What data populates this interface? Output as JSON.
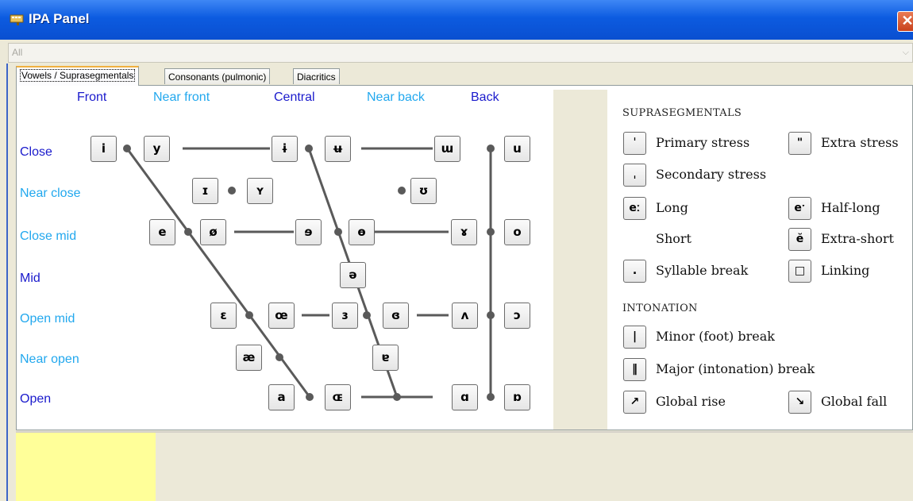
{
  "window": {
    "title": "IPA Panel",
    "close_glyph": "✕"
  },
  "filter": {
    "value": "All",
    "arrow": "⌵"
  },
  "tabs": [
    {
      "label": "Vowels / Suprasegmentals",
      "active": true
    },
    {
      "label": "Consonants (pulmonic)",
      "active": false
    },
    {
      "label": "Diacritics",
      "active": false
    }
  ],
  "vowel_chart": {
    "columns": [
      "Front",
      "Near front",
      "Central",
      "Near back",
      "Back"
    ],
    "rows": [
      "Close",
      "Near close",
      "Close mid",
      "Mid",
      "Open mid",
      "Near open",
      "Open"
    ],
    "colors": {
      "dark": "#1a1acc",
      "light": "#22a8ee",
      "line": "#5a5a5a"
    },
    "vowels": {
      "i": "i",
      "y": "y",
      "barred_i": "ɨ",
      "barred_u": "ʉ",
      "unrounded_u": "ɯ",
      "u": "u",
      "small_cap_i": "ɪ",
      "small_cap_y": "ʏ",
      "upsilon": "ʊ",
      "e": "e",
      "o_slash": "ø",
      "rev_e": "ɘ",
      "barred_o": "ɵ",
      "rams_horn": "ɤ",
      "o": "o",
      "schwa": "ə",
      "epsilon": "ɛ",
      "oe": "œ",
      "rev_epsilon": "ɜ",
      "closed_rev_epsilon": "ɞ",
      "turned_v": "ʌ",
      "open_o": "ɔ",
      "ash": "æ",
      "turned_a": "ɐ",
      "a": "a",
      "small_cap_oe": "ɶ",
      "script_a": "ɑ",
      "turned_script_a": "ɒ"
    }
  },
  "suprasegmentals": {
    "heading": "SUPRASEGMENTALS",
    "items": [
      {
        "symbol": "ˈ",
        "label": "Primary stress"
      },
      {
        "symbol": "\"",
        "label": "Extra stress"
      },
      {
        "symbol": "ˌ",
        "label": "Secondary stress"
      },
      {
        "symbol": "eː",
        "label": "Long"
      },
      {
        "symbol": "eˑ",
        "label": "Half-long"
      },
      {
        "symbol": "",
        "label": "Short"
      },
      {
        "symbol": "ĕ",
        "label": "Extra-short"
      },
      {
        "symbol": ".",
        "label": "Syllable break"
      },
      {
        "symbol": "□",
        "label": "Linking"
      }
    ]
  },
  "intonation": {
    "heading": "INTONATION",
    "items": [
      {
        "symbol": "|",
        "label": "Minor (foot) break"
      },
      {
        "symbol": "‖",
        "label": "Major (intonation) break"
      },
      {
        "symbol": "↗",
        "label": "Global rise"
      },
      {
        "symbol": "↘",
        "label": "Global fall"
      }
    ]
  }
}
